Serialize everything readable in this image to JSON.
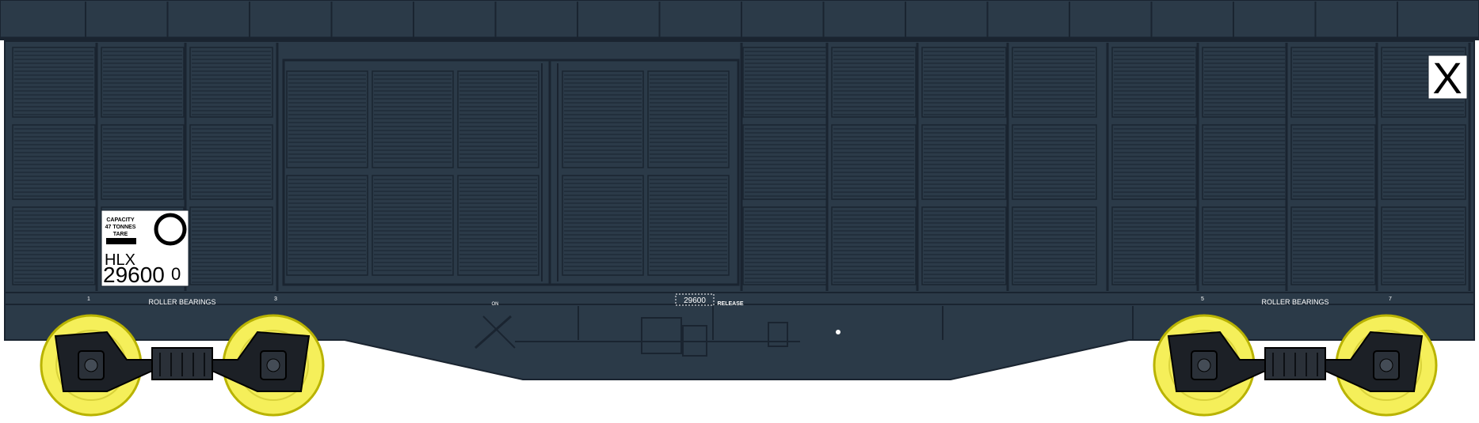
{
  "wagon": {
    "body_color": "#2b3a48",
    "line_color": "#1a2430",
    "wheel_color": "#f5ef5a",
    "bogie_color": "#1c2026",
    "capacity_label": "CAPACITY",
    "capacity_value": "47 TONNES",
    "tare_label": "TARE",
    "reporting_mark": "HLX",
    "number": "29600",
    "check_digit": "0",
    "x_marker": "X"
  },
  "frame": {
    "left_bearings_label": "ROLLER BEARINGS",
    "right_bearings_label": "ROLLER BEARINGS",
    "axle_numbers": [
      "1",
      "3",
      "5",
      "7"
    ],
    "brake_on_label": "ON",
    "center_number": "29600",
    "release_label": "RELEASE"
  }
}
